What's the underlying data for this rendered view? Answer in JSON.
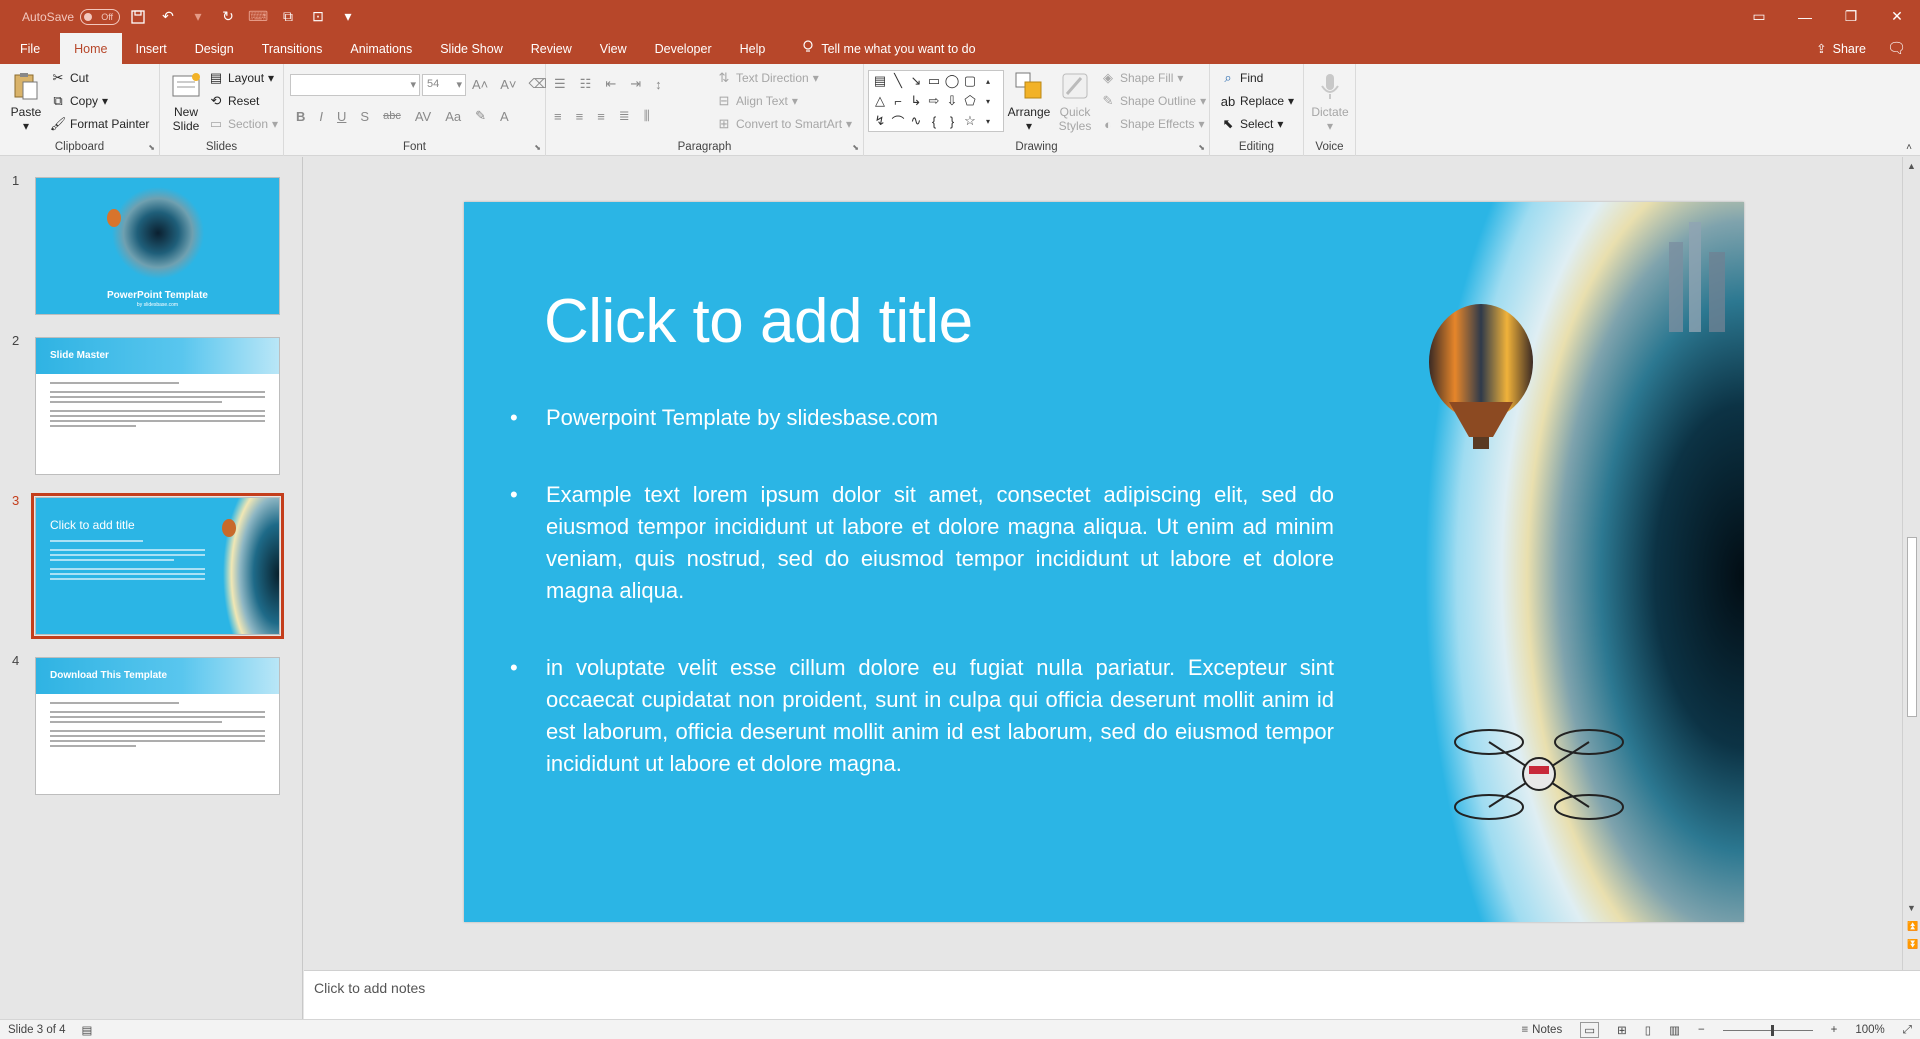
{
  "qat": {
    "autosave_label": "AutoSave",
    "autosave_state": "Off"
  },
  "tabs": [
    {
      "label": "File"
    },
    {
      "label": "Home"
    },
    {
      "label": "Insert"
    },
    {
      "label": "Design"
    },
    {
      "label": "Transitions"
    },
    {
      "label": "Animations"
    },
    {
      "label": "Slide Show"
    },
    {
      "label": "Review"
    },
    {
      "label": "View"
    },
    {
      "label": "Developer"
    },
    {
      "label": "Help"
    }
  ],
  "tellme": "Tell me what you want to do",
  "share": "Share",
  "ribbon": {
    "clipboard": {
      "label": "Clipboard",
      "paste": "Paste",
      "cut": "Cut",
      "copy": "Copy",
      "format_painter": "Format Painter"
    },
    "slides": {
      "label": "Slides",
      "new_slide_1": "New",
      "new_slide_2": "Slide",
      "layout": "Layout",
      "reset": "Reset",
      "section": "Section"
    },
    "font": {
      "label": "Font",
      "size": "54"
    },
    "paragraph": {
      "label": "Paragraph",
      "text_direction": "Text Direction",
      "align_text": "Align Text",
      "smartart": "Convert to SmartArt"
    },
    "drawing": {
      "label": "Drawing",
      "arrange": "Arrange",
      "quick_1": "Quick",
      "quick_2": "Styles",
      "shape_fill": "Shape Fill",
      "shape_outline": "Shape Outline",
      "shape_effects": "Shape Effects"
    },
    "editing": {
      "label": "Editing",
      "find": "Find",
      "replace": "Replace",
      "select": "Select"
    },
    "voice": {
      "label": "Voice",
      "dictate": "Dictate"
    }
  },
  "thumbnails": [
    {
      "num": "1",
      "title": "PowerPoint Template",
      "sub": "by slidesbase.com"
    },
    {
      "num": "2",
      "title": "Slide Master"
    },
    {
      "num": "3",
      "title": "Click to add title"
    },
    {
      "num": "4",
      "title": "Download This Template"
    }
  ],
  "slide": {
    "title": "Click to add title",
    "bullets": [
      "Powerpoint Template by slidesbase.com",
      "Example text lorem ipsum dolor sit amet, consectet adipiscing elit, sed do eiusmod tempor incididunt ut labore et dolore magna aliqua. Ut enim ad minim veniam, quis nostrud, sed do eiusmod tempor incididunt ut labore et dolore magna aliqua.",
      "in voluptate velit esse cillum dolore eu fugiat nulla pariatur. Excepteur sint occaecat cupidatat non proident, sunt in culpa qui officia deserunt mollit anim id est laborum, officia deserunt mollit anim id est laborum, sed do eiusmod tempor incididunt ut labore et dolore magna."
    ]
  },
  "notes_placeholder": "Click to add notes",
  "status": {
    "slide_info": "Slide 3 of 4",
    "notes": "Notes",
    "zoom": "100%"
  },
  "colors": {
    "accent": "#b7472a",
    "slide_bg": "#2bb5e5",
    "selection": "#c43e1c"
  }
}
